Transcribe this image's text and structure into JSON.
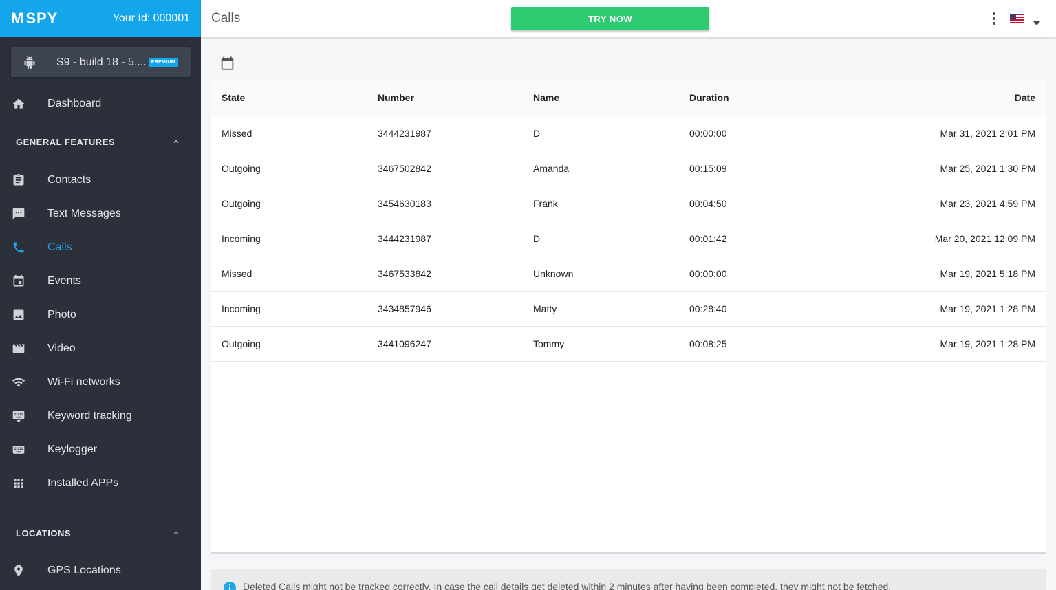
{
  "brand": {
    "logo_text": "SPY",
    "logo_mark": "M",
    "user_id": "Your Id: 000001",
    "color": "#14a6ec"
  },
  "device": {
    "name": "S9 - build 18 - 5....",
    "badge": "PREMIUM"
  },
  "sidebar": {
    "dashboard": "Dashboard",
    "general_header": "GENERAL FEATURES",
    "items": [
      {
        "label": "Contacts",
        "icon": "clipboard-icon"
      },
      {
        "label": "Text Messages",
        "icon": "message-icon"
      },
      {
        "label": "Calls",
        "icon": "phone-icon",
        "active": true
      },
      {
        "label": "Events",
        "icon": "calendar-icon"
      },
      {
        "label": "Photo",
        "icon": "image-icon"
      },
      {
        "label": "Video",
        "icon": "film-icon"
      },
      {
        "label": "Wi-Fi networks",
        "icon": "wifi-icon"
      },
      {
        "label": "Keyword tracking",
        "icon": "keyboard-icon"
      },
      {
        "label": "Keylogger",
        "icon": "keyboard-icon"
      },
      {
        "label": "Installed APPs",
        "icon": "apps-grid-icon"
      }
    ],
    "locations_header": "LOCATIONS",
    "gps": "GPS Locations"
  },
  "header": {
    "title": "Calls",
    "try_now": "TRY NOW",
    "accent": "#2ecc71"
  },
  "table": {
    "columns": [
      "State",
      "Number",
      "Name",
      "Duration",
      "Date"
    ],
    "rows": [
      [
        "Missed",
        "3444231987",
        "D",
        "00:00:00",
        "Mar 31, 2021 2:01 PM"
      ],
      [
        "Outgoing",
        "3467502842",
        "Amanda",
        "00:15:09",
        "Mar 25, 2021 1:30 PM"
      ],
      [
        "Outgoing",
        "3454630183",
        "Frank",
        "00:04:50",
        "Mar 23, 2021 4:59 PM"
      ],
      [
        "Incoming",
        "3444231987",
        "D",
        "00:01:42",
        "Mar 20, 2021 12:09 PM"
      ],
      [
        "Missed",
        "3467533842",
        "Unknown",
        "00:00:00",
        "Mar 19, 2021 5:18 PM"
      ],
      [
        "Incoming",
        "3434857946",
        "Matty",
        "00:28:40",
        "Mar 19, 2021 1:28 PM"
      ],
      [
        "Outgoing",
        "3441096247",
        "Tommy",
        "00:08:25",
        "Mar 19, 2021 1:28 PM"
      ]
    ]
  },
  "info": {
    "text": "Deleted Calls might not be tracked correctly. In case the call details get deleted within 2 minutes after having been completed, they might not be fetched."
  }
}
